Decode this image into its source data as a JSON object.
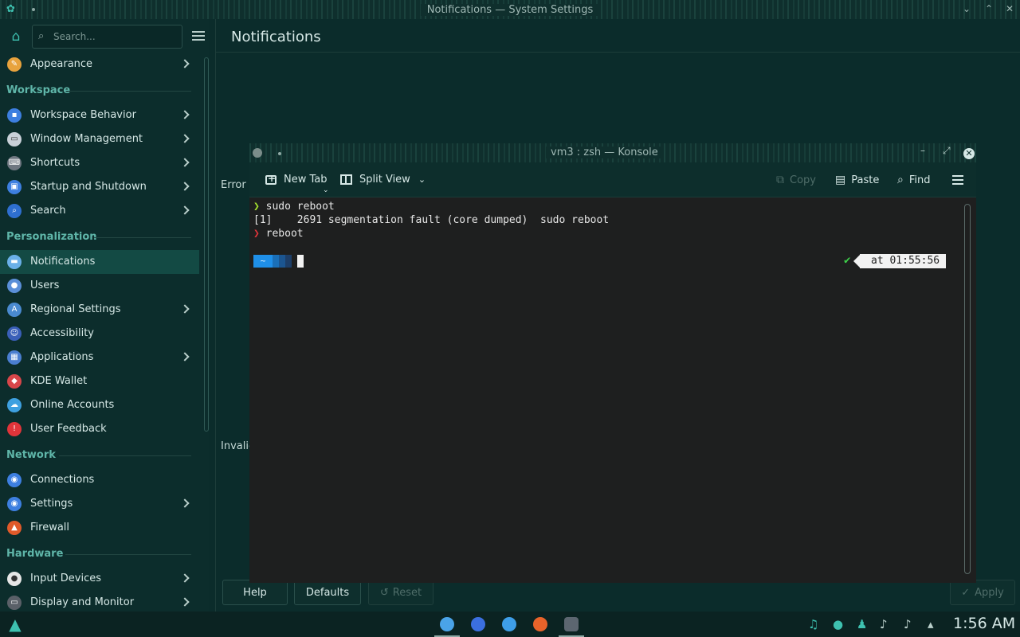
{
  "window": {
    "title": "Notifications — System Settings"
  },
  "sidebar": {
    "search_placeholder": "Search...",
    "items_top": [
      {
        "label": "Appearance",
        "icon": "appearance-icon",
        "color": "#e8a33d"
      }
    ],
    "sections": [
      {
        "title": "Workspace",
        "items": [
          {
            "label": "Workspace Behavior",
            "icon": "workspace-behavior-icon",
            "color": "#3d7fe0"
          },
          {
            "label": "Window Management",
            "icon": "window-management-icon",
            "color": "#c9d1d9"
          },
          {
            "label": "Shortcuts",
            "icon": "shortcuts-icon",
            "color": "#6e7680"
          },
          {
            "label": "Startup and Shutdown",
            "icon": "startup-shutdown-icon",
            "color": "#3d7fe0"
          },
          {
            "label": "Search",
            "icon": "search-icon",
            "color": "#2e6fd0"
          }
        ]
      },
      {
        "title": "Personalization",
        "items": [
          {
            "label": "Notifications",
            "icon": "notifications-icon",
            "color": "#6ab0e8"
          },
          {
            "label": "Users",
            "icon": "users-icon",
            "color": "#5b8fd8"
          },
          {
            "label": "Regional Settings",
            "icon": "regional-settings-icon",
            "color": "#4a8ad0"
          },
          {
            "label": "Accessibility",
            "icon": "accessibility-icon",
            "color": "#3a5fb8"
          },
          {
            "label": "Applications",
            "icon": "applications-icon",
            "color": "#4a7ed0"
          },
          {
            "label": "KDE Wallet",
            "icon": "kde-wallet-icon",
            "color": "#d8464a"
          },
          {
            "label": "Online Accounts",
            "icon": "online-accounts-icon",
            "color": "#3ea0e0"
          },
          {
            "label": "User Feedback",
            "icon": "user-feedback-icon",
            "color": "#e0343a"
          }
        ]
      },
      {
        "title": "Network",
        "items": [
          {
            "label": "Connections",
            "icon": "connections-icon",
            "color": "#3d7fe0"
          },
          {
            "label": "Settings",
            "icon": "network-settings-icon",
            "color": "#3d7fe0"
          },
          {
            "label": "Firewall",
            "icon": "firewall-icon",
            "color": "#e05a2a"
          }
        ]
      },
      {
        "title": "Hardware",
        "items": [
          {
            "label": "Input Devices",
            "icon": "input-devices-icon",
            "color": "#e6e6e6"
          },
          {
            "label": "Display and Monitor",
            "icon": "display-monitor-icon",
            "color": "#5a6068"
          }
        ]
      }
    ]
  },
  "main": {
    "page_title": "Notifications",
    "fragment_error": "Error l",
    "fragment_invalid": "Invalic",
    "buttons": {
      "help": "Help",
      "defaults": "Defaults",
      "reset": "Reset",
      "apply": "Apply"
    }
  },
  "konsole": {
    "title": "vm3 : zsh — Konsole",
    "toolbar": {
      "new_tab": "New Tab",
      "split_view": "Split View",
      "copy": "Copy",
      "paste": "Paste",
      "find": "Find"
    },
    "terminal": {
      "prompt_ok": "❯",
      "cmd1": " sudo reboot",
      "line2": "[1]    2691 segmentation fault (core dumped)  sudo reboot",
      "prompt_err": "❯",
      "cmd2": " reboot",
      "path_segment": "~",
      "status_check": "✔",
      "status_time": "at 01:55:56"
    }
  },
  "taskbar": {
    "clock": "1:56 AM",
    "tasks": [
      {
        "icon": "system-settings-task-icon",
        "color": "#4aa3e8"
      },
      {
        "icon": "discover-task-icon",
        "color": "#3b6fe0"
      },
      {
        "icon": "dolphin-task-icon",
        "color": "#3e9ee8"
      },
      {
        "icon": "firefox-task-icon",
        "color": "#e8632a"
      },
      {
        "icon": "konsole-task-icon",
        "color": "#5c6670"
      }
    ]
  }
}
